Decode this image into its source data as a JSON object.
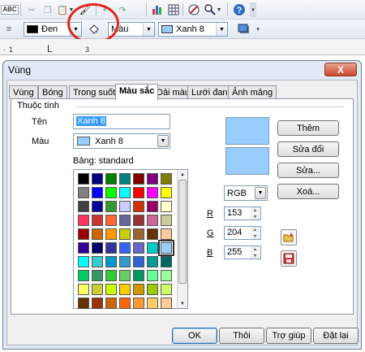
{
  "toolbar": {
    "icons": [
      "abc-spellcheck-icon",
      "scissors-icon",
      "copy-icon",
      "paste-icon",
      "format-paintbrush-icon",
      "undo-icon",
      "redo-icon",
      "chart-icon",
      "table-icon",
      "navigator-icon",
      "zoom-icon",
      "help-icon"
    ],
    "spellcheck_label": "ABC",
    "line_color": {
      "label": "Đen",
      "swatch": "#000000"
    },
    "area_style": {
      "label": "Màu"
    },
    "area_color": {
      "label": "Xanh 8",
      "swatch": "#99ccff"
    },
    "highlight_color": "#e1251d"
  },
  "ruler": {
    "ticks": [
      "1",
      "3"
    ]
  },
  "dialog": {
    "title": "Vùng",
    "close_label": "X",
    "tabs": [
      "Vùng",
      "Bóng",
      "Trong suốt",
      "Màu sắc",
      "Dải màu",
      "Lưới đan",
      "Ảnh mảng"
    ],
    "active_tab": "Màu sắc",
    "section_label": "Thuộc tính",
    "name_label": "Tên",
    "name_value": "Xanh 8",
    "color_label": "Màu",
    "color_value": "Xanh 8",
    "color_swatch": "#99ccff",
    "table_label": "Bảng: standard",
    "palette": [
      [
        "#000000",
        "#000080",
        "#008000",
        "#008080",
        "#800000",
        "#800080",
        "#808000"
      ],
      [
        "#808080",
        "#0000ff",
        "#00ff00",
        "#00ffff",
        "#ff0000",
        "#ff00ff",
        "#ffff00"
      ],
      [
        "#404040",
        "#000099",
        "#339933",
        "#ccccff",
        "#cc3300",
        "#990066",
        "#ffffcc"
      ],
      [
        "#ff3366",
        "#cc3333",
        "#ff6633",
        "#666699",
        "#993333",
        "#cc6699",
        "#cccc99"
      ],
      [
        "#990000",
        "#cc6600",
        "#ff9900",
        "#cccc00",
        "#996633",
        "#663300",
        "#ffcc99"
      ],
      [
        "#330099",
        "#000066",
        "#333399",
        "#3366ff",
        "#6666cc",
        "#00cccc",
        "#99ccff"
      ],
      [
        "#00ffff",
        "#33cccc",
        "#0099cc",
        "#3399cc",
        "#3366cc",
        "#009999",
        "#006666"
      ],
      [
        "#00cc66",
        "#339966",
        "#33cc33",
        "#66cc66",
        "#009966",
        "#66ff99",
        "#99ff99"
      ],
      [
        "#ffff66",
        "#cccc33",
        "#ccff00",
        "#ffcc00",
        "#cc9900",
        "#99cc00",
        "#ccff66"
      ],
      [
        "#663300",
        "#993300",
        "#cc6600",
        "#ff6600",
        "#ff9933",
        "#ffcc66",
        "#ffcc99"
      ]
    ],
    "selected_cell": [
      5,
      6
    ],
    "preview_colors": [
      "#99ccff",
      "#99ccff"
    ],
    "color_model": "RGB",
    "r_label": "R",
    "r_value": "153",
    "g_label": "G",
    "g_value": "204",
    "b_label": "B",
    "b_value": "255",
    "buttons": {
      "add": "Thêm",
      "modify": "Sửa đổi",
      "edit": "Sửa...",
      "delete": "Xoá..."
    },
    "footer": {
      "ok": "OK",
      "cancel": "Thôi",
      "help": "Trợ giúp",
      "reset": "Đặt lại"
    }
  }
}
